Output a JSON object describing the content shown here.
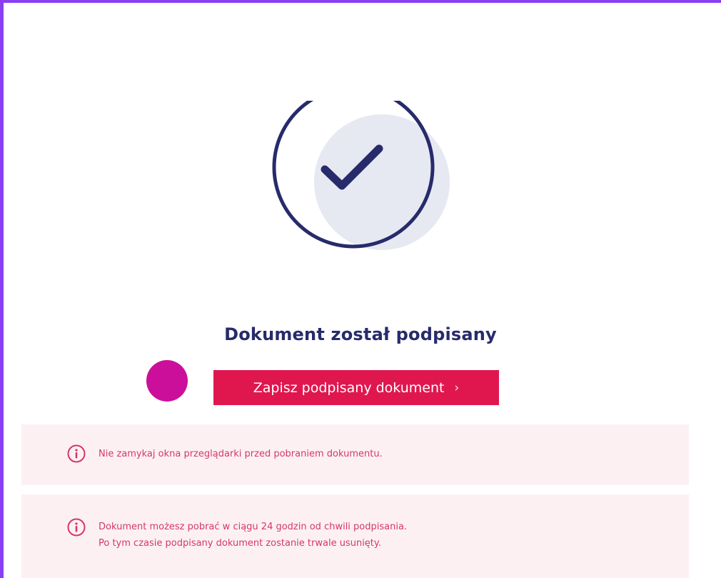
{
  "status": {
    "title": "Dokument został podpisany"
  },
  "actions": {
    "save_label": "Zapisz podpisany dokument",
    "save_chevron": "›"
  },
  "notices": [
    {
      "icon": "info-icon",
      "lines": [
        "Nie zamykaj okna przeglądarki przed pobraniem dokumentu."
      ]
    },
    {
      "icon": "info-icon",
      "lines": [
        "Dokument możesz pobrać w ciągu 24 godzin od chwili podpisania.",
        "Po tym czasie podpisany dokument zostanie trwale usunięty."
      ]
    }
  ],
  "colors": {
    "accent": "#e0174f",
    "navy": "#272b6b",
    "notice_bg": "#fdf0f3",
    "notice_text": "#d3386a",
    "frame": "#8a3ff2",
    "cursor": "#cc0f9a"
  }
}
